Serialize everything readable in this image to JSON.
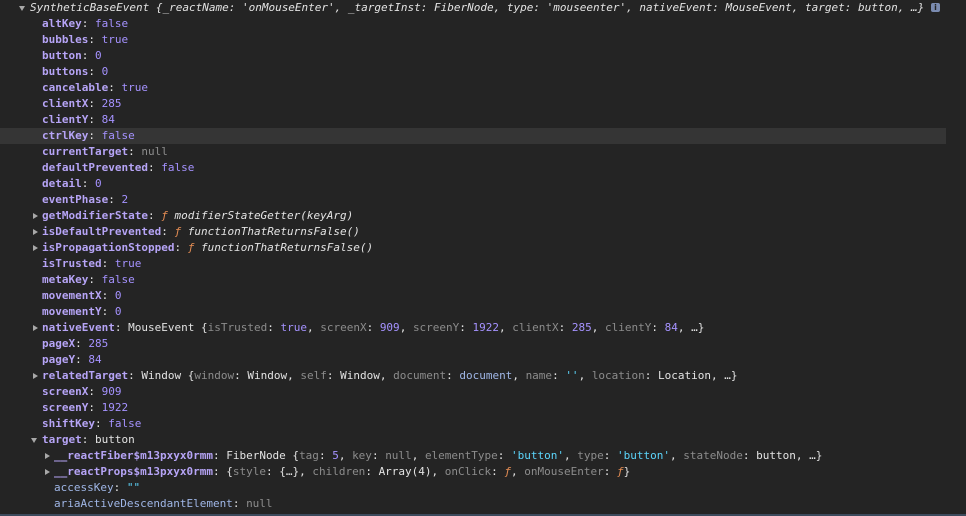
{
  "header": {
    "name": "SyntheticBaseEvent",
    "preview": [
      {
        "k": "_reactName",
        "v": "'onMouseEnter'",
        "t": "str"
      },
      {
        "k": "_targetInst",
        "v": "FiberNode",
        "t": "obj"
      },
      {
        "k": "type",
        "v": "'mouseenter'",
        "t": "str"
      },
      {
        "k": "nativeEvent",
        "v": "MouseEvent",
        "t": "obj"
      },
      {
        "k": "target",
        "v": "button",
        "t": "obj"
      }
    ],
    "ellipsis": "…}"
  },
  "props": {
    "altKey": {
      "k": "altKey",
      "v": "false"
    },
    "bubbles": {
      "k": "bubbles",
      "v": "true"
    },
    "button": {
      "k": "button",
      "v": "0"
    },
    "buttons": {
      "k": "buttons",
      "v": "0"
    },
    "cancelable": {
      "k": "cancelable",
      "v": "true"
    },
    "clientX": {
      "k": "clientX",
      "v": "285"
    },
    "clientY": {
      "k": "clientY",
      "v": "84"
    },
    "ctrlKey": {
      "k": "ctrlKey",
      "v": "false"
    },
    "currentTarget": {
      "k": "currentTarget",
      "v": "null"
    },
    "defaultPrevented": {
      "k": "defaultPrevented",
      "v": "false"
    },
    "detail": {
      "k": "detail",
      "v": "0"
    },
    "eventPhase": {
      "k": "eventPhase",
      "v": "2"
    },
    "getModifierState": {
      "k": "getModifierState",
      "f": "ƒ",
      "v": "modifierStateGetter(keyArg)"
    },
    "isDefaultPrevented": {
      "k": "isDefaultPrevented",
      "f": "ƒ",
      "v": "functionThatReturnsFalse()"
    },
    "isPropagationStopped": {
      "k": "isPropagationStopped",
      "f": "ƒ",
      "v": "functionThatReturnsFalse()"
    },
    "isTrusted": {
      "k": "isTrusted",
      "v": "true"
    },
    "metaKey": {
      "k": "metaKey",
      "v": "false"
    },
    "movementX": {
      "k": "movementX",
      "v": "0"
    },
    "movementY": {
      "k": "movementY",
      "v": "0"
    },
    "nativeEvent": {
      "k": "nativeEvent",
      "cls": "MouseEvent",
      "preview": [
        {
          "k": "isTrusted",
          "v": "true",
          "t": "bool"
        },
        {
          "k": "screenX",
          "v": "909",
          "t": "num"
        },
        {
          "k": "screenY",
          "v": "1922",
          "t": "num"
        },
        {
          "k": "clientX",
          "v": "285",
          "t": "num"
        },
        {
          "k": "clientY",
          "v": "84",
          "t": "num"
        }
      ],
      "ellipsis": "…}"
    },
    "pageX": {
      "k": "pageX",
      "v": "285"
    },
    "pageY": {
      "k": "pageY",
      "v": "84"
    },
    "relatedTarget": {
      "k": "relatedTarget",
      "cls": "Window",
      "preview": [
        {
          "k": "window",
          "v": "Window",
          "t": "obj"
        },
        {
          "k": "self",
          "v": "Window",
          "t": "obj"
        },
        {
          "k": "document",
          "v": "document",
          "t": "node"
        },
        {
          "k": "name",
          "v": "''",
          "t": "str"
        },
        {
          "k": "location",
          "v": "Location",
          "t": "obj"
        }
      ],
      "ellipsis": "…}"
    },
    "screenX": {
      "k": "screenX",
      "v": "909"
    },
    "screenY": {
      "k": "screenY",
      "v": "1922"
    },
    "shiftKey": {
      "k": "shiftKey",
      "v": "false"
    },
    "target": {
      "k": "target",
      "v": "button"
    }
  },
  "target_children": {
    "reactFiber": {
      "k": "__reactFiber$m13pxyx0rmm",
      "cls": "FiberNode",
      "preview": [
        {
          "k": "tag",
          "v": "5",
          "t": "num"
        },
        {
          "k": "key",
          "v": "null",
          "t": "nul"
        },
        {
          "k": "elementType",
          "v": "'button'",
          "t": "str"
        },
        {
          "k": "type",
          "v": "'button'",
          "t": "str"
        },
        {
          "k": "stateNode",
          "v": "button",
          "t": "obj"
        }
      ],
      "ellipsis": "…}"
    },
    "reactProps": {
      "k": "__reactProps$m13pxyx0rmm",
      "preview": [
        {
          "k": "style",
          "v": "{…}",
          "t": "obj"
        },
        {
          "k": "children",
          "v": "Array(4)",
          "t": "obj"
        },
        {
          "k": "onClick",
          "v": "ƒ",
          "t": "fnv"
        },
        {
          "k": "onMouseEnter",
          "v": "ƒ",
          "t": "fnv"
        }
      ],
      "ellipsis": "}"
    },
    "accessKey": {
      "k": "accessKey",
      "v": "\"\""
    },
    "ariaActiveDescendantElement": {
      "k": "ariaActiveDescendantElement",
      "v": "null"
    }
  },
  "icons": {
    "info": "i"
  }
}
